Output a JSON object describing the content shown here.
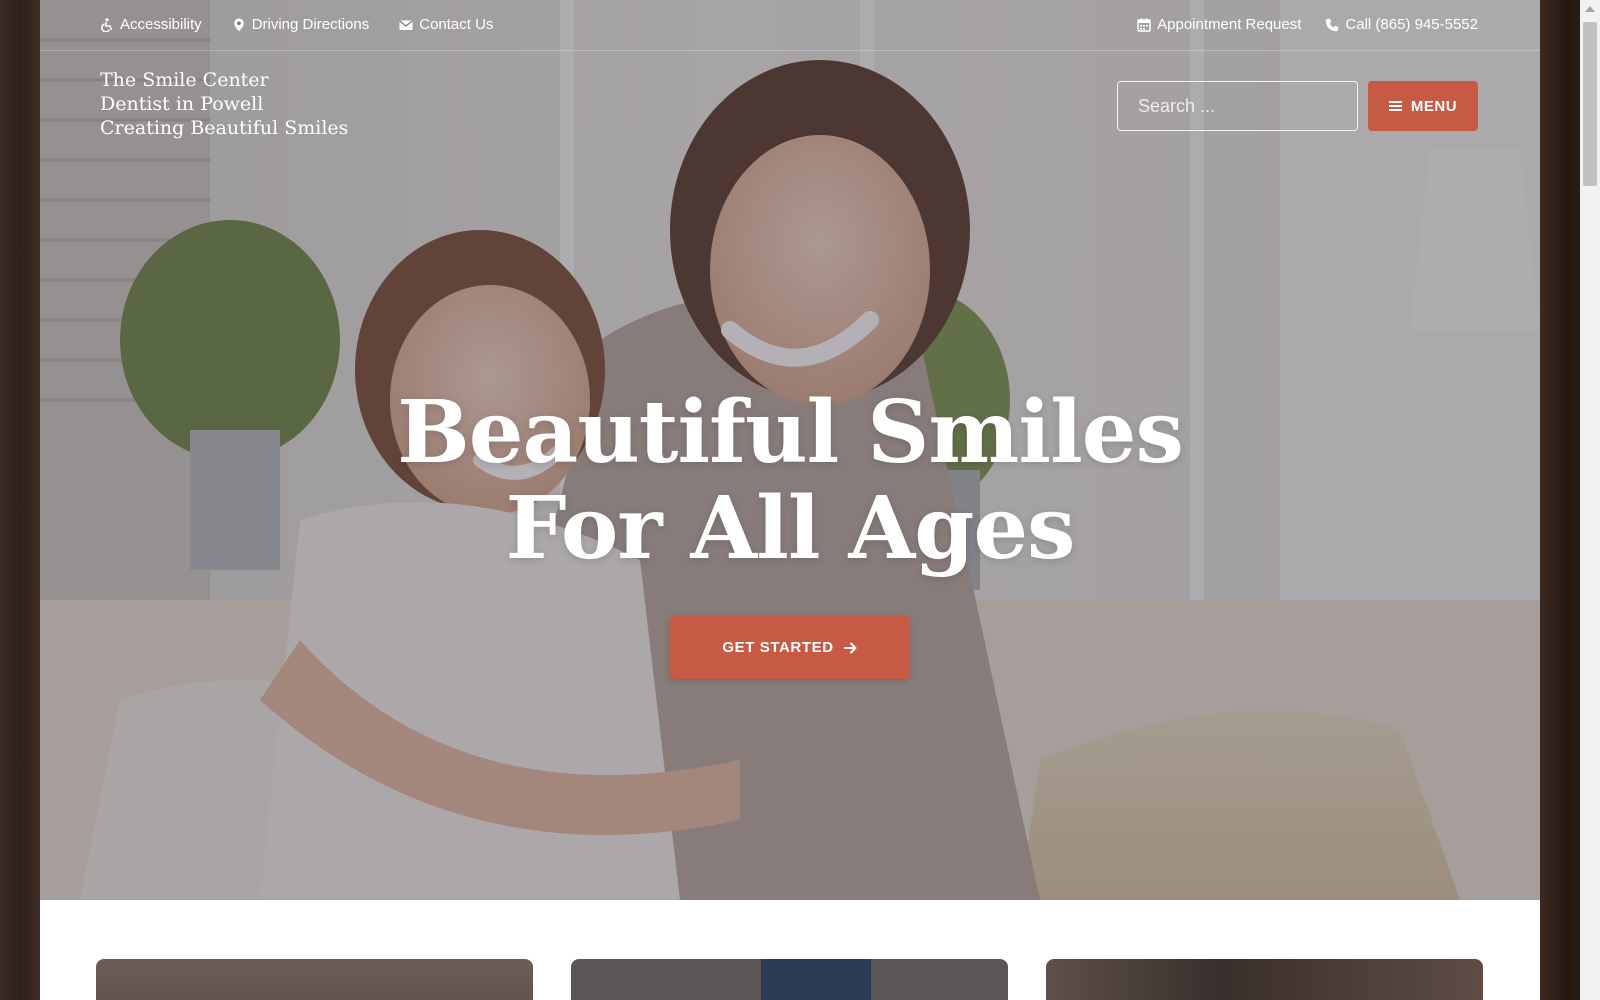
{
  "topbar": {
    "left_links": [
      {
        "label": "Accessibility",
        "icon": "wheelchair-icon"
      },
      {
        "label": "Driving Directions",
        "icon": "map-pin-icon"
      },
      {
        "label": "Contact Us",
        "icon": "envelope-icon"
      }
    ],
    "right_links": [
      {
        "label": "Appointment Request",
        "icon": "calendar-icon"
      },
      {
        "label": "Call (865) 945-5552",
        "icon": "phone-icon"
      }
    ]
  },
  "brand": {
    "line1": "The Smile Center",
    "line2": "Dentist in Powell",
    "line3": "Creating Beautiful Smiles"
  },
  "search": {
    "placeholder": "Search ...",
    "value": ""
  },
  "menu": {
    "label": "MENU"
  },
  "hero": {
    "headline_line1": "Beautiful Smiles",
    "headline_line2": "For All Ages",
    "cta_label": "GET STARTED"
  },
  "colors": {
    "accent": "#c65a45",
    "text_on_hero": "#ffffff",
    "page_bg": "#ffffff"
  }
}
